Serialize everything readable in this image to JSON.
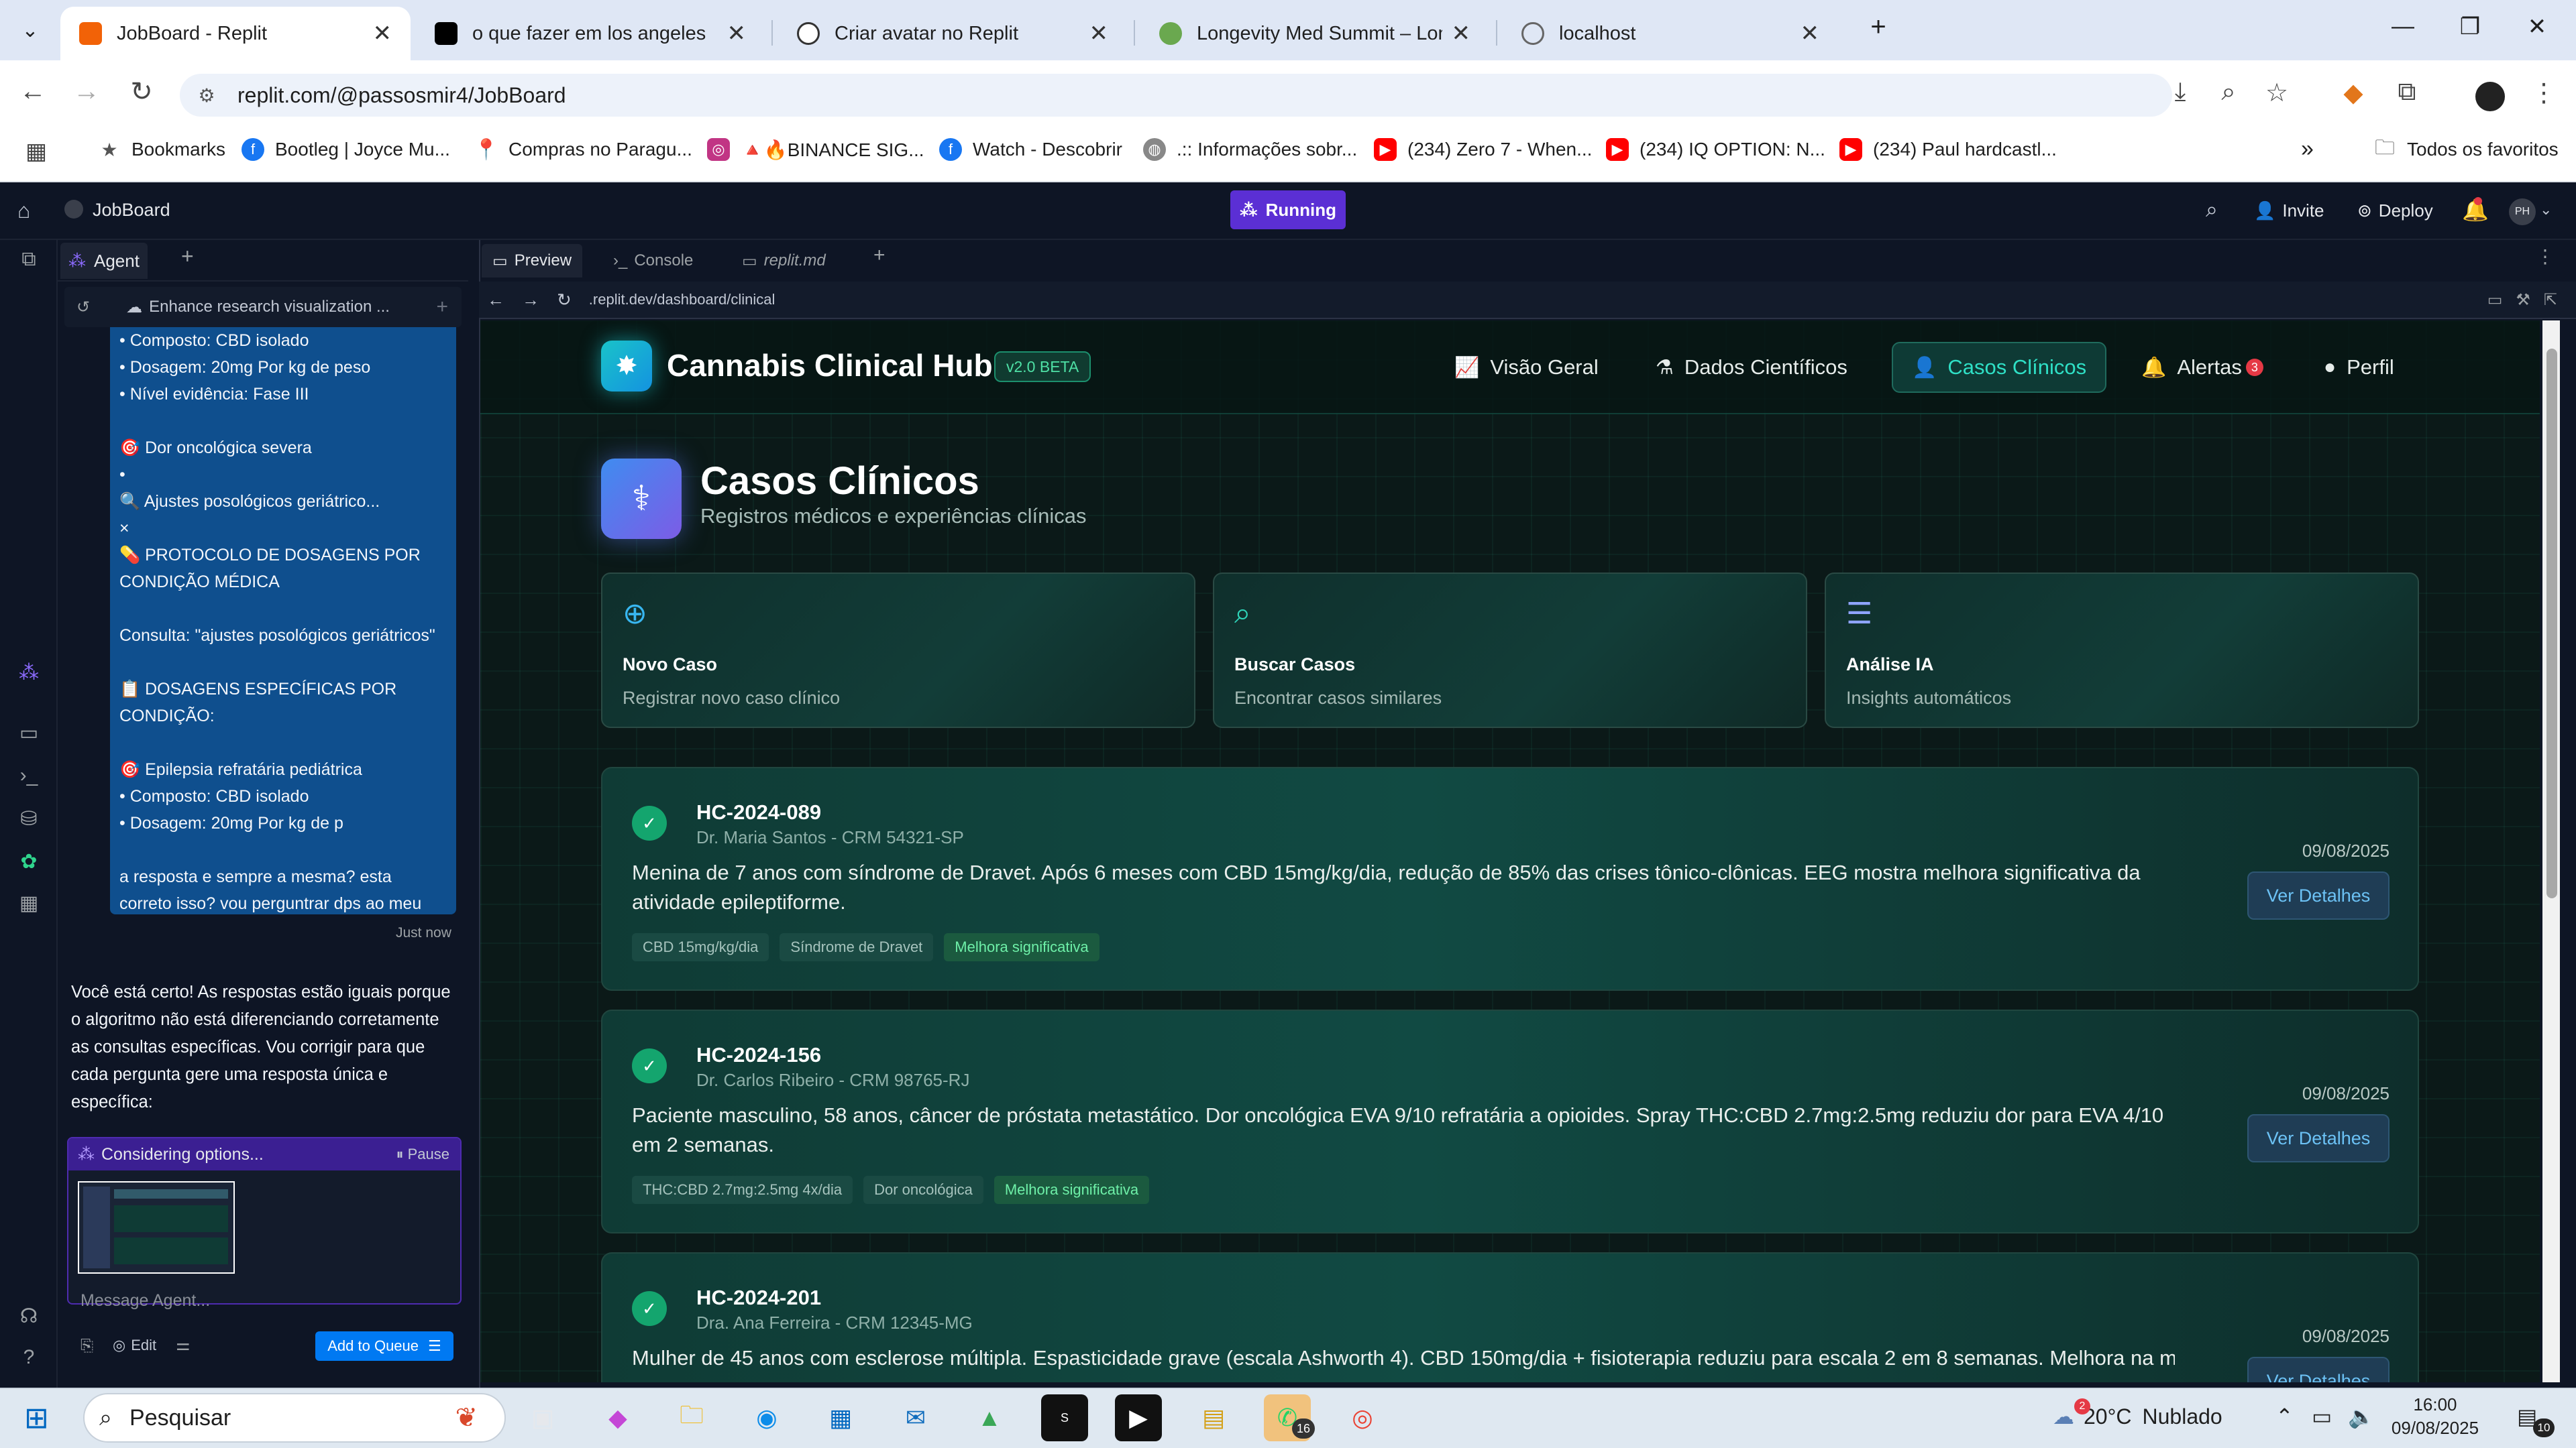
{
  "browser": {
    "tabs": [
      {
        "title": "JobBoard - Replit",
        "active": true
      },
      {
        "title": "o que fazer em los angeles"
      },
      {
        "title": "Criar avatar no Replit"
      },
      {
        "title": "Longevity Med Summit – Longe"
      },
      {
        "title": "localhost"
      }
    ],
    "url": "replit.com/@passosmir4/JobBoard",
    "bookmarks": [
      "Bookmarks",
      "Bootleg | Joyce Mu...",
      "Compras no Paragu...",
      "🔺🔥BINANCE SIG...",
      "Watch - Descobrir",
      ".:: Informações sobr...",
      "(234) Zero 7 - When...",
      "(234) IQ OPTION: N...",
      "(234) Paul hardcastl..."
    ],
    "bookmarks_more": "»",
    "all_bookmarks": "Todos os favoritos"
  },
  "replit": {
    "project": "JobBoard",
    "status": "Running",
    "invite": "Invite",
    "deploy": "Deploy",
    "avatar": "PH",
    "agent_tab": "Agent",
    "agent_thread": "Enhance research visualization ...",
    "user_message": "• Composto: CBD isolado\n• Dosagem: 20mg Por kg de peso\n• Nível evidência: Fase III\n\n🎯 Dor oncológica severa\n•\n🔍 Ajustes posológicos geriátrico...\n×\n💊 PROTOCOLO DE DOSAGENS POR CONDIÇÃO MÉDICA\n\nConsulta: \"ajustes posológicos geriátricos\"\n\n📋 DOSAGENS ESPECÍFICAS POR CONDIÇÃO:\n\n🎯 Epilepsia refratária pediátrica\n• Composto: CBD isolado\n• Dosagem: 20mg Por kg de p\n\na resposta e sempre a mesma? esta correto isso? vou perguntrar dps ao meu socio medico....",
    "user_time": "Just now",
    "agent_reply": "Você está certo! As respostas estão iguais porque o algoritmo não está diferenciando corretamente as consultas específicas. Vou corrigir para que cada pergunta gere uma resposta única e específica:",
    "considering": "Considering options...",
    "pause": "Pause",
    "message_placeholder": "Message Agent...",
    "edit": "Edit",
    "add_to_queue": "Add to Queue",
    "preview_tabs": [
      "Preview",
      "Console",
      "replit.md"
    ],
    "preview_url": ".replit.dev/dashboard/clinical"
  },
  "app": {
    "brand": "Cannabis Clinical Hub",
    "version": "v2.0 BETA",
    "nav": [
      {
        "label": "Visão Geral",
        "icon": "📈"
      },
      {
        "label": "Dados Científicos",
        "icon": "⚗"
      },
      {
        "label": "Casos Clínicos",
        "icon": "👤",
        "active": true
      },
      {
        "label": "Alertas",
        "icon": "🔔",
        "count": "3"
      },
      {
        "label": "Perfil",
        "icon": "●"
      }
    ],
    "page_title": "Casos Clínicos",
    "page_subtitle": "Registros médicos e experiências clínicas",
    "quick_actions": [
      {
        "title": "Novo Caso",
        "subtitle": "Registrar novo caso clínico",
        "icon": "plus-circle-icon",
        "color": "#38b6f0"
      },
      {
        "title": "Buscar Casos",
        "subtitle": "Encontrar casos similares",
        "icon": "search-icon",
        "color": "#2fd4b9"
      },
      {
        "title": "Análise IA",
        "subtitle": "Insights automáticos",
        "icon": "chart-icon",
        "color": "#8fa4ff"
      }
    ],
    "cases": [
      {
        "id": "HC-2024-089",
        "doctor": "Dr. Maria Santos - CRM 54321-SP",
        "description": "Menina de 7 anos com síndrome de Dravet. Após 6 meses com CBD 15mg/kg/dia, redução de 85% das crises tônico-clônicas. EEG mostra melhora significativa da atividade epileptiforme.",
        "date": "09/08/2025",
        "action": "Ver Detalhes",
        "tags": [
          "CBD 15mg/kg/dia",
          "Síndrome de Dravet",
          "Melhora significativa"
        ]
      },
      {
        "id": "HC-2024-156",
        "doctor": "Dr. Carlos Ribeiro - CRM 98765-RJ",
        "description": "Paciente masculino, 58 anos, câncer de próstata metastático. Dor oncológica EVA 9/10 refratária a opioides. Spray THC:CBD 2.7mg:2.5mg reduziu dor para EVA 4/10 em 2 semanas.",
        "date": "09/08/2025",
        "action": "Ver Detalhes",
        "tags": [
          "THC:CBD 2.7mg:2.5mg 4x/dia",
          "Dor oncológica",
          "Melhora significativa"
        ]
      },
      {
        "id": "HC-2024-201",
        "doctor": "Dra. Ana Ferreira - CRM 12345-MG",
        "description": "Mulher de 45 anos com esclerose múltipla. Espasticidade grave (escala Ashworth 4). CBD 150mg/dia + fisioterapia reduziu para escala 2 em 8 semanas. Melhora na marcha",
        "date": "09/08/2025",
        "action": "Ver Detalhes",
        "tags": []
      }
    ]
  },
  "taskbar": {
    "search": "Pesquisar",
    "weather_temp": "20°C",
    "weather_text": "Nublado",
    "weather_badge": "2",
    "time": "16:00",
    "date": "09/08/2025",
    "whatsapp_badge": "16",
    "notif_badge": "10"
  }
}
